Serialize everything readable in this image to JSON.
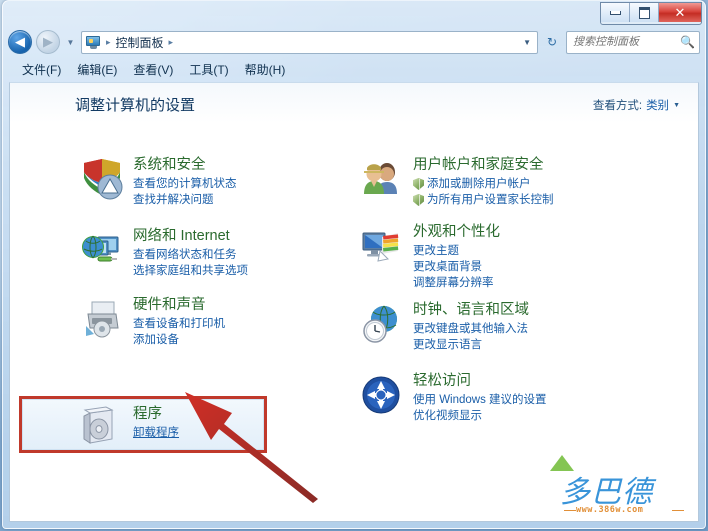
{
  "window": {
    "buttons": {
      "minimize": "–",
      "maximize": "□",
      "close": "✕"
    }
  },
  "addressbar": {
    "back_glyph": "◀",
    "forward_glyph": "▶",
    "history_caret": "▼",
    "icon": "control-panel-icon",
    "crumb": "控制面板",
    "separator": "▸",
    "dropdown_caret": "▼",
    "refresh_glyph": "↻"
  },
  "search": {
    "placeholder": "搜索控制面板",
    "value": "",
    "icon": "search-icon"
  },
  "menubar": {
    "items": [
      "文件(F)",
      "编辑(E)",
      "查看(V)",
      "工具(T)",
      "帮助(H)"
    ]
  },
  "page": {
    "title": "调整计算机的设置",
    "view_by_label": "查看方式:",
    "view_by_value": "类别",
    "view_by_caret": "▼"
  },
  "categories": {
    "left": [
      {
        "name": "system-and-security",
        "title": "系统和安全",
        "links": [
          {
            "text": "查看您的计算机状态",
            "shield": false
          },
          {
            "text": "查找并解决问题",
            "shield": false
          }
        ]
      },
      {
        "name": "network-and-internet",
        "title": "网络和 Internet",
        "links": [
          {
            "text": "查看网络状态和任务",
            "shield": false
          },
          {
            "text": "选择家庭组和共享选项",
            "shield": false
          }
        ]
      },
      {
        "name": "hardware-and-sound",
        "title": "硬件和声音",
        "links": [
          {
            "text": "查看设备和打印机",
            "shield": false
          },
          {
            "text": "添加设备",
            "shield": false
          }
        ]
      },
      {
        "name": "programs",
        "title": "程序",
        "links": [
          {
            "text": "卸载程序",
            "shield": false,
            "hovered": true
          }
        ]
      }
    ],
    "right": [
      {
        "name": "user-accounts-and-family-safety",
        "title": "用户帐户和家庭安全",
        "links": [
          {
            "text": "添加或删除用户帐户",
            "shield": true
          },
          {
            "text": "为所有用户设置家长控制",
            "shield": true
          }
        ]
      },
      {
        "name": "appearance-and-personalization",
        "title": "外观和个性化",
        "links": [
          {
            "text": "更改主题",
            "shield": false
          },
          {
            "text": "更改桌面背景",
            "shield": false
          },
          {
            "text": "调整屏幕分辨率",
            "shield": false
          }
        ]
      },
      {
        "name": "clock-language-and-region",
        "title": "时钟、语言和区域",
        "links": [
          {
            "text": "更改键盘或其他输入法",
            "shield": false
          },
          {
            "text": "更改显示语言",
            "shield": false
          }
        ]
      },
      {
        "name": "ease-of-access",
        "title": "轻松访问",
        "links": [
          {
            "text": "使用 Windows 建议的设置",
            "shield": false
          },
          {
            "text": "优化视频显示",
            "shield": false
          }
        ]
      }
    ]
  },
  "annotation": {
    "highlight_color": "#c0392b",
    "arrow_color": "#cc2b24",
    "target": "卸载程序"
  },
  "watermark": {
    "text": "多巴德",
    "url": "www.386w.com"
  }
}
